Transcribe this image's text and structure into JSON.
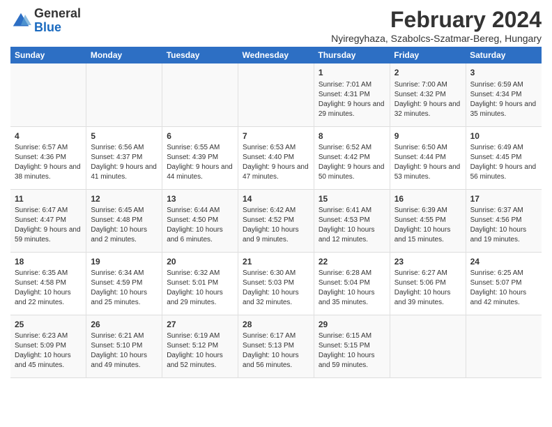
{
  "logo": {
    "general": "General",
    "blue": "Blue"
  },
  "title": "February 2024",
  "location": "Nyiregyhaza, Szabolcs-Szatmar-Bereg, Hungary",
  "days_of_week": [
    "Sunday",
    "Monday",
    "Tuesday",
    "Wednesday",
    "Thursday",
    "Friday",
    "Saturday"
  ],
  "weeks": [
    [
      {
        "day": "",
        "info": ""
      },
      {
        "day": "",
        "info": ""
      },
      {
        "day": "",
        "info": ""
      },
      {
        "day": "",
        "info": ""
      },
      {
        "day": "1",
        "info": "Sunrise: 7:01 AM\nSunset: 4:31 PM\nDaylight: 9 hours and 29 minutes."
      },
      {
        "day": "2",
        "info": "Sunrise: 7:00 AM\nSunset: 4:32 PM\nDaylight: 9 hours and 32 minutes."
      },
      {
        "day": "3",
        "info": "Sunrise: 6:59 AM\nSunset: 4:34 PM\nDaylight: 9 hours and 35 minutes."
      }
    ],
    [
      {
        "day": "4",
        "info": "Sunrise: 6:57 AM\nSunset: 4:36 PM\nDaylight: 9 hours and 38 minutes."
      },
      {
        "day": "5",
        "info": "Sunrise: 6:56 AM\nSunset: 4:37 PM\nDaylight: 9 hours and 41 minutes."
      },
      {
        "day": "6",
        "info": "Sunrise: 6:55 AM\nSunset: 4:39 PM\nDaylight: 9 hours and 44 minutes."
      },
      {
        "day": "7",
        "info": "Sunrise: 6:53 AM\nSunset: 4:40 PM\nDaylight: 9 hours and 47 minutes."
      },
      {
        "day": "8",
        "info": "Sunrise: 6:52 AM\nSunset: 4:42 PM\nDaylight: 9 hours and 50 minutes."
      },
      {
        "day": "9",
        "info": "Sunrise: 6:50 AM\nSunset: 4:44 PM\nDaylight: 9 hours and 53 minutes."
      },
      {
        "day": "10",
        "info": "Sunrise: 6:49 AM\nSunset: 4:45 PM\nDaylight: 9 hours and 56 minutes."
      }
    ],
    [
      {
        "day": "11",
        "info": "Sunrise: 6:47 AM\nSunset: 4:47 PM\nDaylight: 9 hours and 59 minutes."
      },
      {
        "day": "12",
        "info": "Sunrise: 6:45 AM\nSunset: 4:48 PM\nDaylight: 10 hours and 2 minutes."
      },
      {
        "day": "13",
        "info": "Sunrise: 6:44 AM\nSunset: 4:50 PM\nDaylight: 10 hours and 6 minutes."
      },
      {
        "day": "14",
        "info": "Sunrise: 6:42 AM\nSunset: 4:52 PM\nDaylight: 10 hours and 9 minutes."
      },
      {
        "day": "15",
        "info": "Sunrise: 6:41 AM\nSunset: 4:53 PM\nDaylight: 10 hours and 12 minutes."
      },
      {
        "day": "16",
        "info": "Sunrise: 6:39 AM\nSunset: 4:55 PM\nDaylight: 10 hours and 15 minutes."
      },
      {
        "day": "17",
        "info": "Sunrise: 6:37 AM\nSunset: 4:56 PM\nDaylight: 10 hours and 19 minutes."
      }
    ],
    [
      {
        "day": "18",
        "info": "Sunrise: 6:35 AM\nSunset: 4:58 PM\nDaylight: 10 hours and 22 minutes."
      },
      {
        "day": "19",
        "info": "Sunrise: 6:34 AM\nSunset: 4:59 PM\nDaylight: 10 hours and 25 minutes."
      },
      {
        "day": "20",
        "info": "Sunrise: 6:32 AM\nSunset: 5:01 PM\nDaylight: 10 hours and 29 minutes."
      },
      {
        "day": "21",
        "info": "Sunrise: 6:30 AM\nSunset: 5:03 PM\nDaylight: 10 hours and 32 minutes."
      },
      {
        "day": "22",
        "info": "Sunrise: 6:28 AM\nSunset: 5:04 PM\nDaylight: 10 hours and 35 minutes."
      },
      {
        "day": "23",
        "info": "Sunrise: 6:27 AM\nSunset: 5:06 PM\nDaylight: 10 hours and 39 minutes."
      },
      {
        "day": "24",
        "info": "Sunrise: 6:25 AM\nSunset: 5:07 PM\nDaylight: 10 hours and 42 minutes."
      }
    ],
    [
      {
        "day": "25",
        "info": "Sunrise: 6:23 AM\nSunset: 5:09 PM\nDaylight: 10 hours and 45 minutes."
      },
      {
        "day": "26",
        "info": "Sunrise: 6:21 AM\nSunset: 5:10 PM\nDaylight: 10 hours and 49 minutes."
      },
      {
        "day": "27",
        "info": "Sunrise: 6:19 AM\nSunset: 5:12 PM\nDaylight: 10 hours and 52 minutes."
      },
      {
        "day": "28",
        "info": "Sunrise: 6:17 AM\nSunset: 5:13 PM\nDaylight: 10 hours and 56 minutes."
      },
      {
        "day": "29",
        "info": "Sunrise: 6:15 AM\nSunset: 5:15 PM\nDaylight: 10 hours and 59 minutes."
      },
      {
        "day": "",
        "info": ""
      },
      {
        "day": "",
        "info": ""
      }
    ]
  ]
}
